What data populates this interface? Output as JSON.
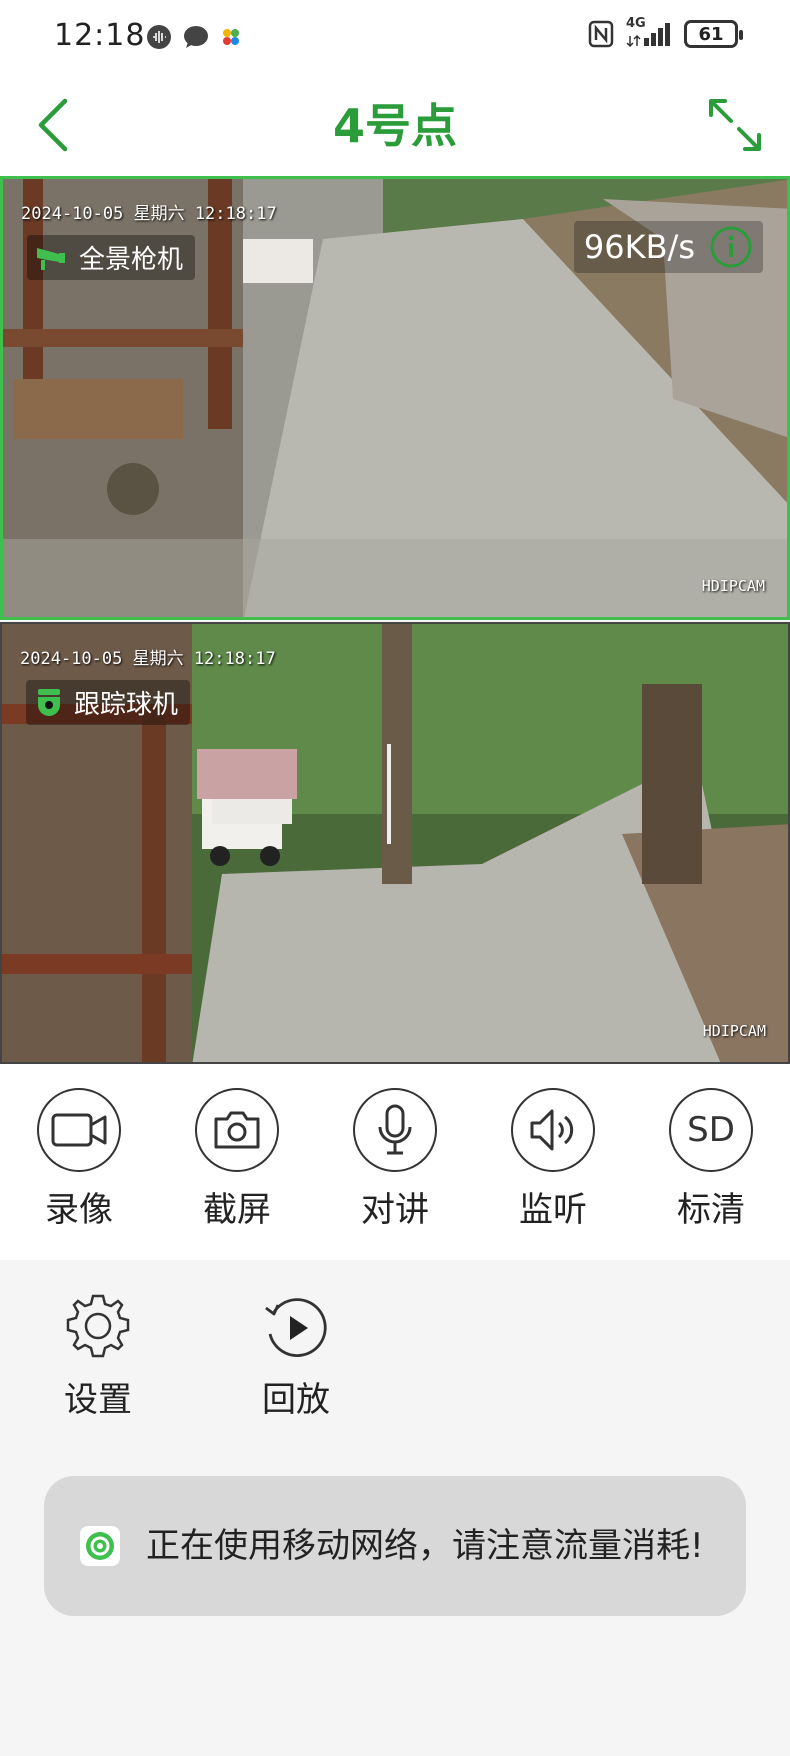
{
  "status_bar": {
    "time": "12:18",
    "battery": "61",
    "network": "4G"
  },
  "header": {
    "title": "4号点"
  },
  "cameras": [
    {
      "timestamp": "2024-10-05 星期六 12:18:17",
      "name": "全景枪机",
      "rate": "96KB/s",
      "brand": "HDIPCAM"
    },
    {
      "timestamp": "2024-10-05 星期六 12:18:17",
      "name": "跟踪球机",
      "brand": "HDIPCAM"
    }
  ],
  "controls": [
    {
      "label": "录像",
      "icon": "video-camera-icon"
    },
    {
      "label": "截屏",
      "icon": "camera-icon"
    },
    {
      "label": "对讲",
      "icon": "microphone-icon"
    },
    {
      "label": "监听",
      "icon": "speaker-icon"
    },
    {
      "label": "标清",
      "icon": "sd-icon",
      "icon_text": "SD"
    }
  ],
  "tools": [
    {
      "label": "设置",
      "icon": "gear-icon"
    },
    {
      "label": "回放",
      "icon": "playback-icon"
    }
  ],
  "toast": {
    "message": "正在使用移动网络，请注意流量消耗!"
  },
  "colors": {
    "accent": "#2a9d3a",
    "selected_border": "#3fbf4d"
  }
}
